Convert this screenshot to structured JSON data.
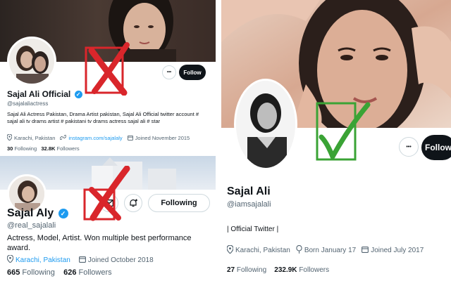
{
  "panel_a": {
    "name": "Sajal Ali Official",
    "handle": "@sajalaliactress",
    "bio": "Sajal Ali Actress  Pakistan, Drama Artist pakistan, Sajal Ali Official twitter account # sajal ali tv drams artist # pakistani tv drams actress sajal ali # star",
    "location": "Karachi, Pakistan",
    "website": "instagram.com/sajalaly",
    "joined": "Joined November 2015",
    "following_count": "30",
    "following_label": "Following",
    "followers_count": "32.8K",
    "followers_label": "Followers",
    "more_label": "•••",
    "follow_label": "Follow",
    "verified_icon": "verified-badge-icon",
    "mark": "red-cross-icon"
  },
  "panel_b": {
    "name": "Sajal Aly",
    "handle": "@real_sajalali",
    "bio": "Actress, Model, Artist. Won multiple best performance award.",
    "location": "Karachi, Pakistan",
    "joined": "Joined October 2018",
    "following_count": "665",
    "following_label": "Following",
    "followers_count": "626",
    "followers_label": "Followers",
    "following_button_label": "Following",
    "verified_icon": "verified-badge-icon",
    "mark": "red-cross-icon"
  },
  "panel_c": {
    "name": "Sajal Ali",
    "handle": "@iamsajalali",
    "bio": "| Official Twitter |",
    "location": "Karachi, Pakistan",
    "born": "Born January 17",
    "joined": "Joined July 2017",
    "following_count": "27",
    "following_label": "Following",
    "followers_count": "232.9K",
    "followers_label": "Followers",
    "more_label": "•••",
    "follow_label": "Follow",
    "mark": "green-check-icon"
  },
  "colors": {
    "accent": "#1d9bf0",
    "cross": "#d9262b",
    "check": "#3aa335",
    "button_dark": "#0f1419"
  }
}
